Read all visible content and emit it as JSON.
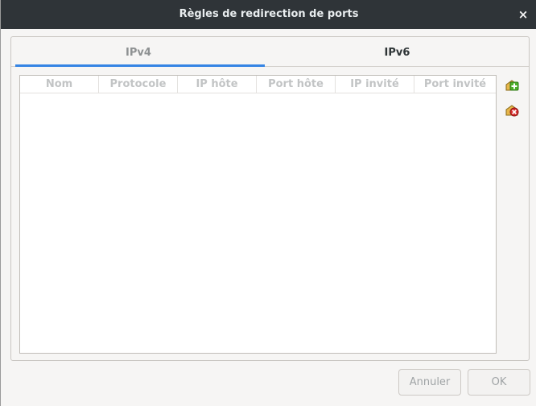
{
  "window": {
    "title": "Règles de redirection de ports",
    "close_glyph": "×"
  },
  "tabs": [
    {
      "label": "IPv4",
      "active": true
    },
    {
      "label": "IPv6",
      "active": false
    }
  ],
  "table": {
    "columns": [
      "Nom",
      "Protocole",
      "IP hôte",
      "Port hôte",
      "IP invité",
      "Port invité"
    ],
    "rows": []
  },
  "side_actions": {
    "add_icon": "add-rule-icon",
    "remove_icon": "remove-rule-icon"
  },
  "footer": {
    "cancel_label": "Annuler",
    "ok_label": "OK"
  },
  "colors": {
    "titlebar": "#2f3438",
    "accent": "#3584e4",
    "dialog_bg": "#f6f5f4",
    "table_bg": "#ffffff",
    "icon_green": "#4caf2a",
    "icon_red": "#d62b2b"
  }
}
